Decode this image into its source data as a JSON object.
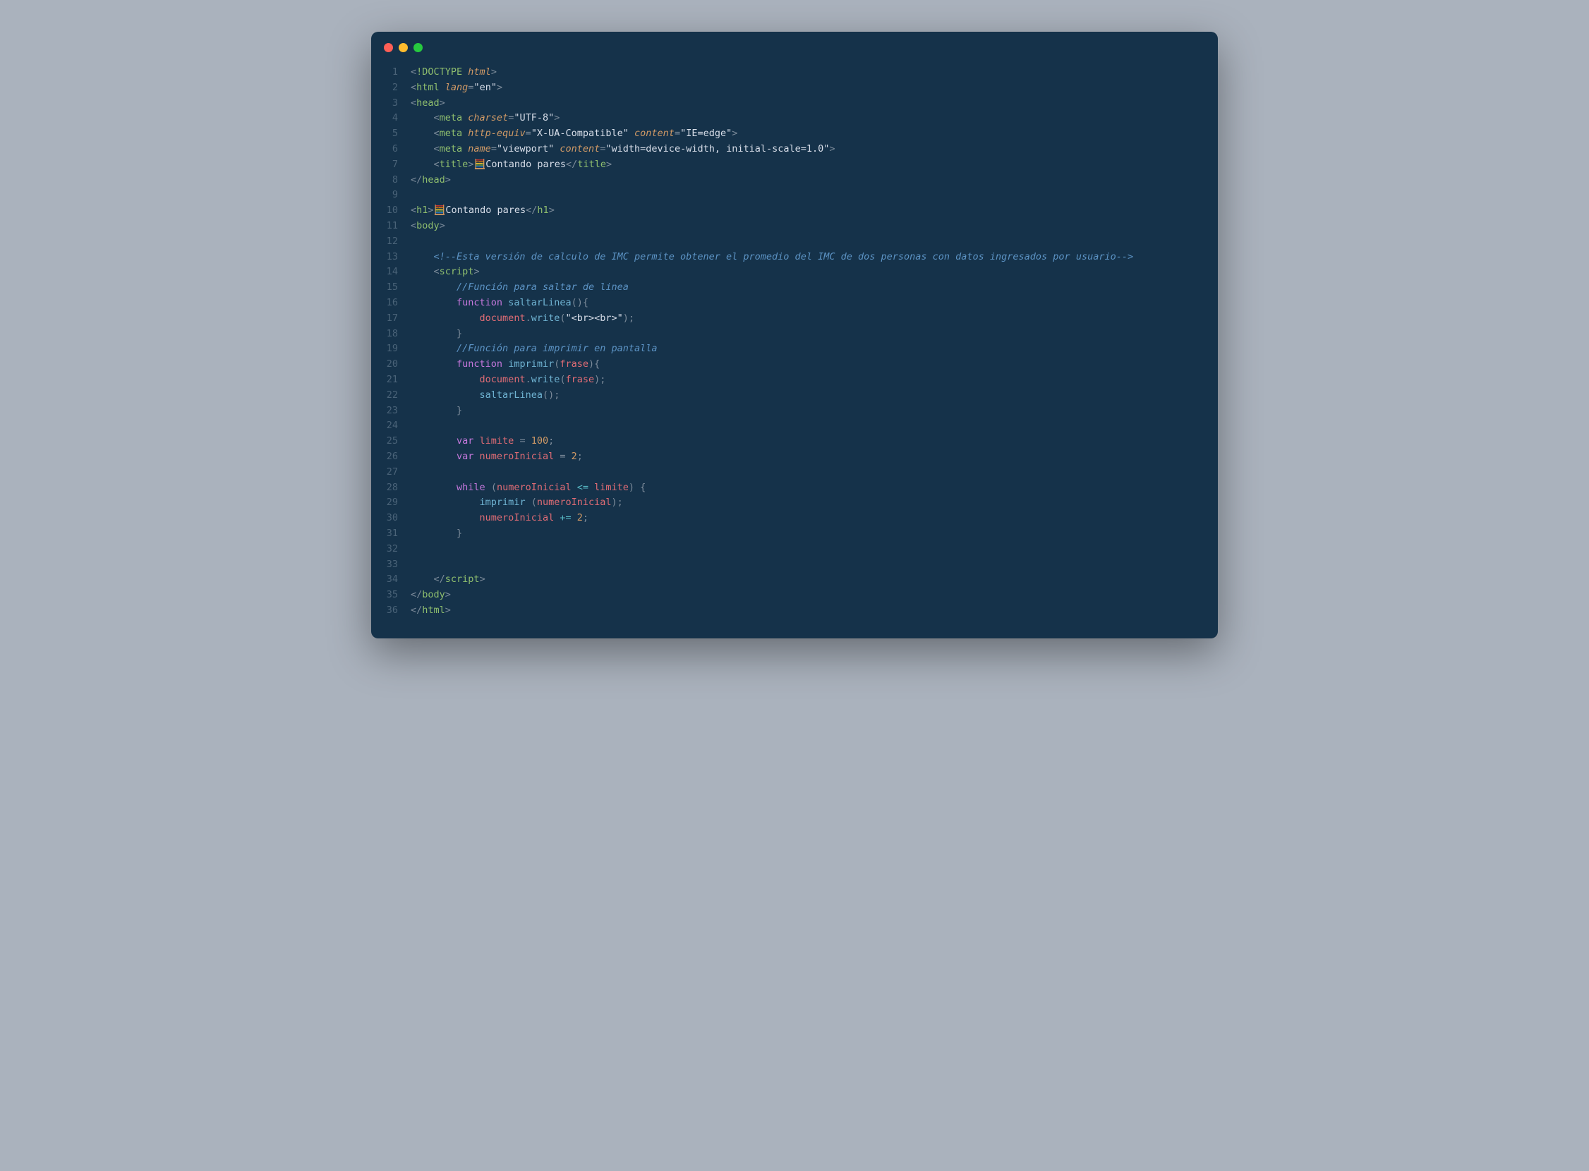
{
  "titlebar": {
    "dots": [
      "red",
      "yellow",
      "green"
    ]
  },
  "lines": [
    [
      {
        "t": "<",
        "c": "punc"
      },
      {
        "t": "!DOCTYPE ",
        "c": "tag"
      },
      {
        "t": "html",
        "c": "attr"
      },
      {
        "t": ">",
        "c": "punc"
      }
    ],
    [
      {
        "t": "<",
        "c": "punc"
      },
      {
        "t": "html ",
        "c": "tag"
      },
      {
        "t": "lang",
        "c": "attr"
      },
      {
        "t": "=",
        "c": "punc"
      },
      {
        "t": "\"en\"",
        "c": "str"
      },
      {
        "t": ">",
        "c": "punc"
      }
    ],
    [
      {
        "t": "<",
        "c": "punc"
      },
      {
        "t": "head",
        "c": "tag"
      },
      {
        "t": ">",
        "c": "punc"
      }
    ],
    [
      {
        "t": "    ",
        "c": ""
      },
      {
        "t": "<",
        "c": "punc"
      },
      {
        "t": "meta ",
        "c": "tag"
      },
      {
        "t": "charset",
        "c": "attr"
      },
      {
        "t": "=",
        "c": "punc"
      },
      {
        "t": "\"UTF-8\"",
        "c": "str"
      },
      {
        "t": ">",
        "c": "punc"
      }
    ],
    [
      {
        "t": "    ",
        "c": ""
      },
      {
        "t": "<",
        "c": "punc"
      },
      {
        "t": "meta ",
        "c": "tag"
      },
      {
        "t": "http-equiv",
        "c": "attr"
      },
      {
        "t": "=",
        "c": "punc"
      },
      {
        "t": "\"X-UA-Compatible\" ",
        "c": "str"
      },
      {
        "t": "content",
        "c": "attr"
      },
      {
        "t": "=",
        "c": "punc"
      },
      {
        "t": "\"IE=edge\"",
        "c": "str"
      },
      {
        "t": ">",
        "c": "punc"
      }
    ],
    [
      {
        "t": "    ",
        "c": ""
      },
      {
        "t": "<",
        "c": "punc"
      },
      {
        "t": "meta ",
        "c": "tag"
      },
      {
        "t": "name",
        "c": "attr"
      },
      {
        "t": "=",
        "c": "punc"
      },
      {
        "t": "\"viewport\" ",
        "c": "str"
      },
      {
        "t": "content",
        "c": "attr"
      },
      {
        "t": "=",
        "c": "punc"
      },
      {
        "t": "\"width=device-width, initial-scale=1.0\"",
        "c": "str"
      },
      {
        "t": ">",
        "c": "punc"
      }
    ],
    [
      {
        "t": "    ",
        "c": ""
      },
      {
        "t": "<",
        "c": "punc"
      },
      {
        "t": "title",
        "c": "tag"
      },
      {
        "t": ">",
        "c": "punc"
      },
      {
        "t": "🧮",
        "c": "emoji"
      },
      {
        "t": "Contando pares",
        "c": "str"
      },
      {
        "t": "</",
        "c": "punc"
      },
      {
        "t": "title",
        "c": "tag"
      },
      {
        "t": ">",
        "c": "punc"
      }
    ],
    [
      {
        "t": "</",
        "c": "punc"
      },
      {
        "t": "head",
        "c": "tag"
      },
      {
        "t": ">",
        "c": "punc"
      }
    ],
    [
      {
        "t": "",
        "c": ""
      }
    ],
    [
      {
        "t": "<",
        "c": "punc"
      },
      {
        "t": "h1",
        "c": "tag"
      },
      {
        "t": ">",
        "c": "punc"
      },
      {
        "t": "🧮",
        "c": "emoji"
      },
      {
        "t": "Contando pares",
        "c": "str"
      },
      {
        "t": "</",
        "c": "punc"
      },
      {
        "t": "h1",
        "c": "tag"
      },
      {
        "t": ">",
        "c": "punc"
      }
    ],
    [
      {
        "t": "<",
        "c": "punc"
      },
      {
        "t": "body",
        "c": "tag"
      },
      {
        "t": ">",
        "c": "punc"
      }
    ],
    [
      {
        "t": "",
        "c": ""
      }
    ],
    [
      {
        "t": "    ",
        "c": ""
      },
      {
        "t": "<!--Esta versión de calculo de IMC permite obtener el promedio del IMC de dos personas con datos ingresados por usuario-->",
        "c": "cmt"
      }
    ],
    [
      {
        "t": "    ",
        "c": ""
      },
      {
        "t": "<",
        "c": "punc"
      },
      {
        "t": "script",
        "c": "tag"
      },
      {
        "t": ">",
        "c": "punc"
      }
    ],
    [
      {
        "t": "        ",
        "c": ""
      },
      {
        "t": "//Función para saltar de linea",
        "c": "cmt"
      }
    ],
    [
      {
        "t": "        ",
        "c": ""
      },
      {
        "t": "function ",
        "c": "kw"
      },
      {
        "t": "saltarLinea",
        "c": "fn"
      },
      {
        "t": "(){",
        "c": "punc"
      }
    ],
    [
      {
        "t": "            ",
        "c": ""
      },
      {
        "t": "document",
        "c": "var"
      },
      {
        "t": ".",
        "c": "punc"
      },
      {
        "t": "write",
        "c": "fn"
      },
      {
        "t": "(",
        "c": "punc"
      },
      {
        "t": "\"<br><br>\"",
        "c": "str"
      },
      {
        "t": ");",
        "c": "punc"
      }
    ],
    [
      {
        "t": "        }",
        "c": "punc"
      }
    ],
    [
      {
        "t": "        ",
        "c": ""
      },
      {
        "t": "//Función para imprimir en pantalla",
        "c": "cmt"
      }
    ],
    [
      {
        "t": "        ",
        "c": ""
      },
      {
        "t": "function ",
        "c": "kw"
      },
      {
        "t": "imprimir",
        "c": "fn"
      },
      {
        "t": "(",
        "c": "punc"
      },
      {
        "t": "frase",
        "c": "var"
      },
      {
        "t": "){",
        "c": "punc"
      }
    ],
    [
      {
        "t": "            ",
        "c": ""
      },
      {
        "t": "document",
        "c": "var"
      },
      {
        "t": ".",
        "c": "punc"
      },
      {
        "t": "write",
        "c": "fn"
      },
      {
        "t": "(",
        "c": "punc"
      },
      {
        "t": "frase",
        "c": "var"
      },
      {
        "t": ");",
        "c": "punc"
      }
    ],
    [
      {
        "t": "            ",
        "c": ""
      },
      {
        "t": "saltarLinea",
        "c": "fn"
      },
      {
        "t": "();",
        "c": "punc"
      }
    ],
    [
      {
        "t": "        }",
        "c": "punc"
      }
    ],
    [
      {
        "t": "",
        "c": ""
      }
    ],
    [
      {
        "t": "        ",
        "c": ""
      },
      {
        "t": "var ",
        "c": "kw"
      },
      {
        "t": "limite",
        "c": "var"
      },
      {
        "t": " = ",
        "c": "punc"
      },
      {
        "t": "100",
        "c": "num"
      },
      {
        "t": ";",
        "c": "punc"
      }
    ],
    [
      {
        "t": "        ",
        "c": ""
      },
      {
        "t": "var ",
        "c": "kw"
      },
      {
        "t": "numeroInicial",
        "c": "var"
      },
      {
        "t": " = ",
        "c": "punc"
      },
      {
        "t": "2",
        "c": "num"
      },
      {
        "t": ";",
        "c": "punc"
      }
    ],
    [
      {
        "t": "",
        "c": ""
      }
    ],
    [
      {
        "t": "        ",
        "c": ""
      },
      {
        "t": "while ",
        "c": "kw"
      },
      {
        "t": "(",
        "c": "punc"
      },
      {
        "t": "numeroInicial",
        "c": "var"
      },
      {
        "t": " <= ",
        "c": "op"
      },
      {
        "t": "limite",
        "c": "var"
      },
      {
        "t": ") {",
        "c": "punc"
      }
    ],
    [
      {
        "t": "            ",
        "c": ""
      },
      {
        "t": "imprimir ",
        "c": "fn"
      },
      {
        "t": "(",
        "c": "punc"
      },
      {
        "t": "numeroInicial",
        "c": "var"
      },
      {
        "t": ");",
        "c": "punc"
      }
    ],
    [
      {
        "t": "            ",
        "c": ""
      },
      {
        "t": "numeroInicial",
        "c": "var"
      },
      {
        "t": " += ",
        "c": "op"
      },
      {
        "t": "2",
        "c": "num"
      },
      {
        "t": ";",
        "c": "punc"
      }
    ],
    [
      {
        "t": "        }",
        "c": "punc"
      }
    ],
    [
      {
        "t": "",
        "c": ""
      }
    ],
    [
      {
        "t": "",
        "c": ""
      }
    ],
    [
      {
        "t": "    ",
        "c": ""
      },
      {
        "t": "</",
        "c": "punc"
      },
      {
        "t": "script",
        "c": "tag"
      },
      {
        "t": ">",
        "c": "punc"
      }
    ],
    [
      {
        "t": "</",
        "c": "punc"
      },
      {
        "t": "body",
        "c": "tag"
      },
      {
        "t": ">",
        "c": "punc"
      }
    ],
    [
      {
        "t": "</",
        "c": "punc"
      },
      {
        "t": "html",
        "c": "tag"
      },
      {
        "t": ">",
        "c": "punc"
      }
    ]
  ]
}
